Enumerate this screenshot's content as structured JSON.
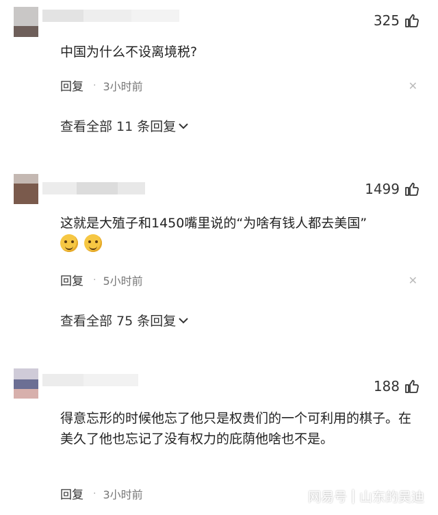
{
  "comments": [
    {
      "likes": "325",
      "text": "中国为什么不设离境税?",
      "reply_label": "回复",
      "time": "3小时前",
      "replies_label": "查看全部 11 条回复"
    },
    {
      "likes": "1499",
      "text": "这就是大殖子和1450嘴里说的“为啥有钱人都去美国”",
      "reply_label": "回复",
      "time": "5小时前",
      "replies_label": "查看全部 75 条回复"
    },
    {
      "likes": "188",
      "text": "得意忘形的时候他忘了他只是权贵们的一个可利用的棋子。在美久了他也忘记了没有权力的庇荫他啥也不是。",
      "reply_label": "回复",
      "time": "3小时前"
    }
  ],
  "icons": {
    "like": "thumbs-up-icon",
    "close": "close-icon",
    "expand": "chevron-down-icon"
  },
  "watermark": {
    "brand": "网易号",
    "author": "山东的吴迪"
  }
}
